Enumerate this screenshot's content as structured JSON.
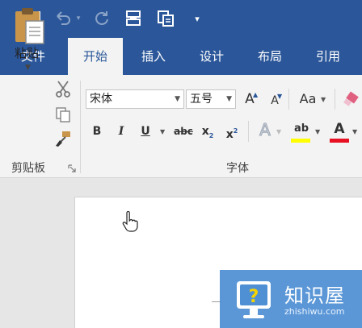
{
  "quick_access": {
    "icons": [
      "save-icon",
      "undo-icon",
      "redo-icon",
      "touch-mode-icon",
      "copy-format-icon",
      "customize-dropdown-icon"
    ]
  },
  "tabs": [
    "文件",
    "开始",
    "插入",
    "设计",
    "布局",
    "引用"
  ],
  "active_tab": "开始",
  "clipboard": {
    "paste_label": "粘贴",
    "group_label": "剪贴板"
  },
  "font": {
    "font_name": "宋体",
    "font_size": "五号",
    "grow_label": "A",
    "shrink_label": "A",
    "case_label": "Aa",
    "bold": "B",
    "italic": "I",
    "underline": "U",
    "strike": "abc",
    "subscript": "x",
    "subscript_mark": "2",
    "superscript": "x",
    "superscript_mark": "2",
    "effects": "A",
    "highlight": "ab",
    "font_color": "A",
    "group_label": "字体"
  },
  "colors": {
    "ribbon_blue": "#2b579a",
    "highlight_yellow": "#ffff00",
    "font_red": "#e81123"
  },
  "watermark": {
    "title": "知识屋",
    "subtitle": "zhishiwu.com"
  }
}
